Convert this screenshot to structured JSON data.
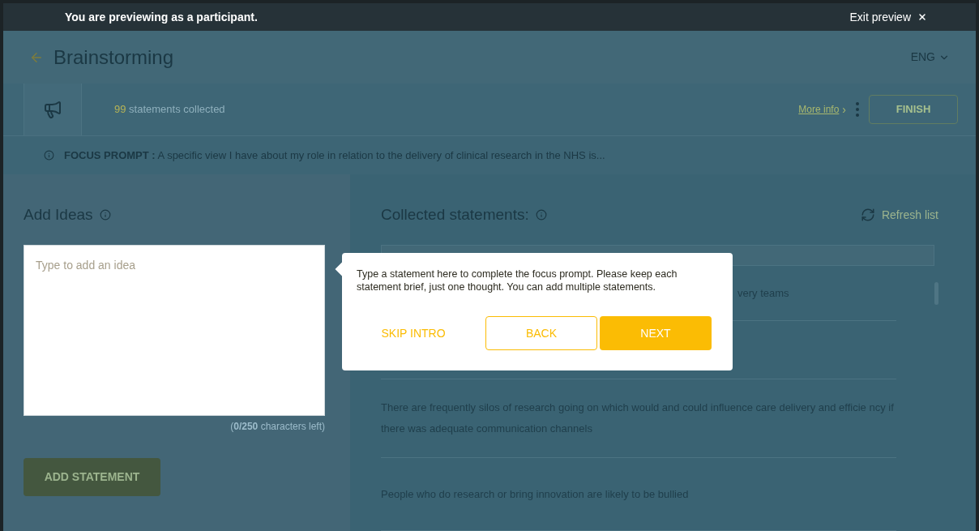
{
  "preview_banner": {
    "message": "You are previewing as a participant.",
    "exit_label": "Exit preview"
  },
  "header": {
    "title": "Brainstorming",
    "language": "ENG"
  },
  "toolbar": {
    "count": "99",
    "count_label": "statements collected",
    "more_info": "More info",
    "more_info_chevron": "›",
    "finish": "FINISH"
  },
  "focus_prompt": {
    "label": "FOCUS PROMPT :",
    "text": "A specific view I have about my role in relation to the delivery of clinical research in the NHS is..."
  },
  "add_ideas": {
    "title": "Add Ideas",
    "placeholder": "Type to add an idea",
    "counter": "(**0/250** characters left)",
    "button": "ADD STATEMENT"
  },
  "collected": {
    "title": "Collected statements:",
    "refresh": "Refresh list",
    "statements": [
      {
        "text": "very teams"
      },
      {
        "text": "There are frequently silos of research going on which would and could influence care delivery and efficie ncy if there was adequate communication channels"
      },
      {
        "text": "People who do research or bring innovation are likely to be bullied"
      }
    ]
  },
  "tooltip": {
    "text": "Type a statement here to complete the focus prompt. Please keep each statement brief, just one thought. You can add multiple statements.",
    "skip": "SKIP INTRO",
    "back": "BACK",
    "next": "NEXT"
  }
}
